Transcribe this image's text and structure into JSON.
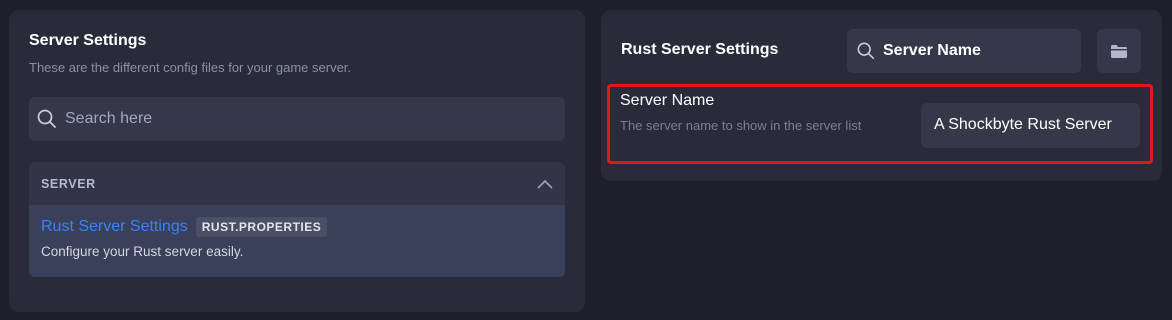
{
  "server_settings": {
    "title": "Server Settings",
    "subtitle": "These are the different config files for your game server.",
    "search_placeholder": "Search here",
    "section": {
      "label": "SERVER",
      "items": [
        {
          "title": "Rust Server Settings",
          "tag": "RUST.PROPERTIES",
          "description": "Configure your Rust server easily."
        }
      ]
    }
  },
  "rust_settings": {
    "title": "Rust Server Settings",
    "search_value": "Server Name",
    "settings": [
      {
        "name": "Server Name",
        "description": "The server name to show in the server list",
        "value": "A Shockbyte Rust Server"
      }
    ]
  },
  "icons": {
    "search": "search-icon",
    "collapse": "chevron-up-icon",
    "folder": "folder-icon"
  },
  "colors": {
    "accent_link": "#3b82f6",
    "highlight_border": "#e0161b",
    "panel_bg": "#2a2b3a",
    "page_bg": "#1e1f2c"
  }
}
